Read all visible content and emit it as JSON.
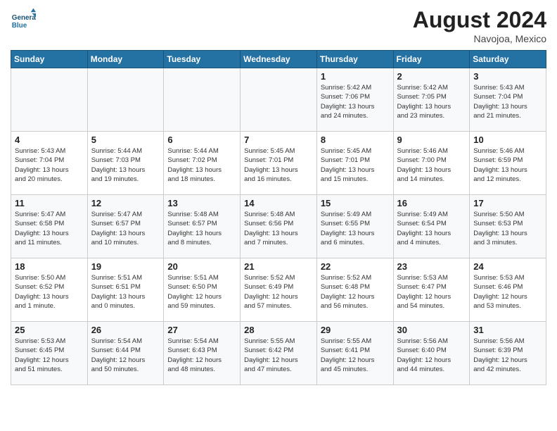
{
  "header": {
    "logo_line1": "General",
    "logo_line2": "Blue",
    "month_year": "August 2024",
    "location": "Navojoa, Mexico"
  },
  "days_of_week": [
    "Sunday",
    "Monday",
    "Tuesday",
    "Wednesday",
    "Thursday",
    "Friday",
    "Saturday"
  ],
  "weeks": [
    [
      {
        "day": "",
        "info": ""
      },
      {
        "day": "",
        "info": ""
      },
      {
        "day": "",
        "info": ""
      },
      {
        "day": "",
        "info": ""
      },
      {
        "day": "1",
        "info": "Sunrise: 5:42 AM\nSunset: 7:06 PM\nDaylight: 13 hours\nand 24 minutes."
      },
      {
        "day": "2",
        "info": "Sunrise: 5:42 AM\nSunset: 7:05 PM\nDaylight: 13 hours\nand 23 minutes."
      },
      {
        "day": "3",
        "info": "Sunrise: 5:43 AM\nSunset: 7:04 PM\nDaylight: 13 hours\nand 21 minutes."
      }
    ],
    [
      {
        "day": "4",
        "info": "Sunrise: 5:43 AM\nSunset: 7:04 PM\nDaylight: 13 hours\nand 20 minutes."
      },
      {
        "day": "5",
        "info": "Sunrise: 5:44 AM\nSunset: 7:03 PM\nDaylight: 13 hours\nand 19 minutes."
      },
      {
        "day": "6",
        "info": "Sunrise: 5:44 AM\nSunset: 7:02 PM\nDaylight: 13 hours\nand 18 minutes."
      },
      {
        "day": "7",
        "info": "Sunrise: 5:45 AM\nSunset: 7:01 PM\nDaylight: 13 hours\nand 16 minutes."
      },
      {
        "day": "8",
        "info": "Sunrise: 5:45 AM\nSunset: 7:01 PM\nDaylight: 13 hours\nand 15 minutes."
      },
      {
        "day": "9",
        "info": "Sunrise: 5:46 AM\nSunset: 7:00 PM\nDaylight: 13 hours\nand 14 minutes."
      },
      {
        "day": "10",
        "info": "Sunrise: 5:46 AM\nSunset: 6:59 PM\nDaylight: 13 hours\nand 12 minutes."
      }
    ],
    [
      {
        "day": "11",
        "info": "Sunrise: 5:47 AM\nSunset: 6:58 PM\nDaylight: 13 hours\nand 11 minutes."
      },
      {
        "day": "12",
        "info": "Sunrise: 5:47 AM\nSunset: 6:57 PM\nDaylight: 13 hours\nand 10 minutes."
      },
      {
        "day": "13",
        "info": "Sunrise: 5:48 AM\nSunset: 6:57 PM\nDaylight: 13 hours\nand 8 minutes."
      },
      {
        "day": "14",
        "info": "Sunrise: 5:48 AM\nSunset: 6:56 PM\nDaylight: 13 hours\nand 7 minutes."
      },
      {
        "day": "15",
        "info": "Sunrise: 5:49 AM\nSunset: 6:55 PM\nDaylight: 13 hours\nand 6 minutes."
      },
      {
        "day": "16",
        "info": "Sunrise: 5:49 AM\nSunset: 6:54 PM\nDaylight: 13 hours\nand 4 minutes."
      },
      {
        "day": "17",
        "info": "Sunrise: 5:50 AM\nSunset: 6:53 PM\nDaylight: 13 hours\nand 3 minutes."
      }
    ],
    [
      {
        "day": "18",
        "info": "Sunrise: 5:50 AM\nSunset: 6:52 PM\nDaylight: 13 hours\nand 1 minute."
      },
      {
        "day": "19",
        "info": "Sunrise: 5:51 AM\nSunset: 6:51 PM\nDaylight: 13 hours\nand 0 minutes."
      },
      {
        "day": "20",
        "info": "Sunrise: 5:51 AM\nSunset: 6:50 PM\nDaylight: 12 hours\nand 59 minutes."
      },
      {
        "day": "21",
        "info": "Sunrise: 5:52 AM\nSunset: 6:49 PM\nDaylight: 12 hours\nand 57 minutes."
      },
      {
        "day": "22",
        "info": "Sunrise: 5:52 AM\nSunset: 6:48 PM\nDaylight: 12 hours\nand 56 minutes."
      },
      {
        "day": "23",
        "info": "Sunrise: 5:53 AM\nSunset: 6:47 PM\nDaylight: 12 hours\nand 54 minutes."
      },
      {
        "day": "24",
        "info": "Sunrise: 5:53 AM\nSunset: 6:46 PM\nDaylight: 12 hours\nand 53 minutes."
      }
    ],
    [
      {
        "day": "25",
        "info": "Sunrise: 5:53 AM\nSunset: 6:45 PM\nDaylight: 12 hours\nand 51 minutes."
      },
      {
        "day": "26",
        "info": "Sunrise: 5:54 AM\nSunset: 6:44 PM\nDaylight: 12 hours\nand 50 minutes."
      },
      {
        "day": "27",
        "info": "Sunrise: 5:54 AM\nSunset: 6:43 PM\nDaylight: 12 hours\nand 48 minutes."
      },
      {
        "day": "28",
        "info": "Sunrise: 5:55 AM\nSunset: 6:42 PM\nDaylight: 12 hours\nand 47 minutes."
      },
      {
        "day": "29",
        "info": "Sunrise: 5:55 AM\nSunset: 6:41 PM\nDaylight: 12 hours\nand 45 minutes."
      },
      {
        "day": "30",
        "info": "Sunrise: 5:56 AM\nSunset: 6:40 PM\nDaylight: 12 hours\nand 44 minutes."
      },
      {
        "day": "31",
        "info": "Sunrise: 5:56 AM\nSunset: 6:39 PM\nDaylight: 12 hours\nand 42 minutes."
      }
    ]
  ]
}
